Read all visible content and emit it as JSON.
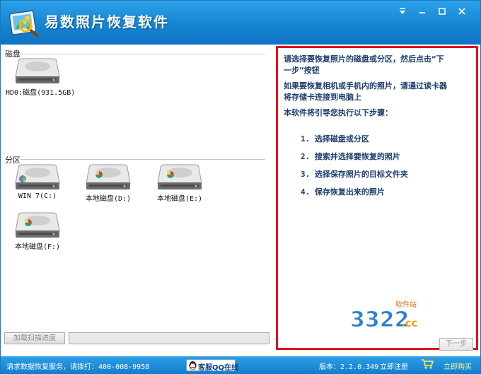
{
  "window": {
    "title": "易数照片恢复软件",
    "controls": {
      "menu": "▼",
      "minimize": "—",
      "maximize": "□",
      "close": "✕"
    }
  },
  "left": {
    "disk_section_label": "磁盘",
    "disks": [
      {
        "label": "HD0:磁盘(931.5GB)",
        "icon": "hard-disk-icon"
      }
    ],
    "partition_section_label": "分区",
    "partitions": [
      {
        "label": "WIN 7(C:)",
        "icon": "system-drive-icon"
      },
      {
        "label": "本地磁盘(D:)",
        "icon": "local-drive-icon"
      },
      {
        "label": "本地磁盘(E:)",
        "icon": "local-drive-icon"
      },
      {
        "label": "本地磁盘(F:)",
        "icon": "local-drive-icon"
      }
    ],
    "load_scan_label": "加载扫描进度",
    "scan_progress": 0
  },
  "right": {
    "instruction_1a": "请选择要恢复照片的磁盘或分区，然后点击“下",
    "instruction_1b": "一步”按钮",
    "instruction_2a": "如果要恢复相机或手机内的照片，请通过读卡器",
    "instruction_2b": "将存储卡连接到电脑上",
    "instruction_3": "本软件将引导您执行以下步骤：",
    "steps": [
      "1.  选择磁盘或分区",
      "2.  搜索并选择要恢复的照片",
      "3.  选择保存照片的目标文件夹",
      "4.  保存恢复出来的照片"
    ],
    "watermark_number": "3322",
    "watermark_suffix": ".cc",
    "watermark_tag": "软件站",
    "next_label": "下一步"
  },
  "statusbar": {
    "service_text": "请求数据恢复服务，请拨打：400-008-9958",
    "qq_label": "客服QQ在线",
    "version": "版本：2.2.0.349",
    "register": "立即注册",
    "buy": "立即购买"
  },
  "colors": {
    "accent": "#1585d4",
    "highlight_border": "#e0141b",
    "text_blue": "#1f3f6e"
  }
}
